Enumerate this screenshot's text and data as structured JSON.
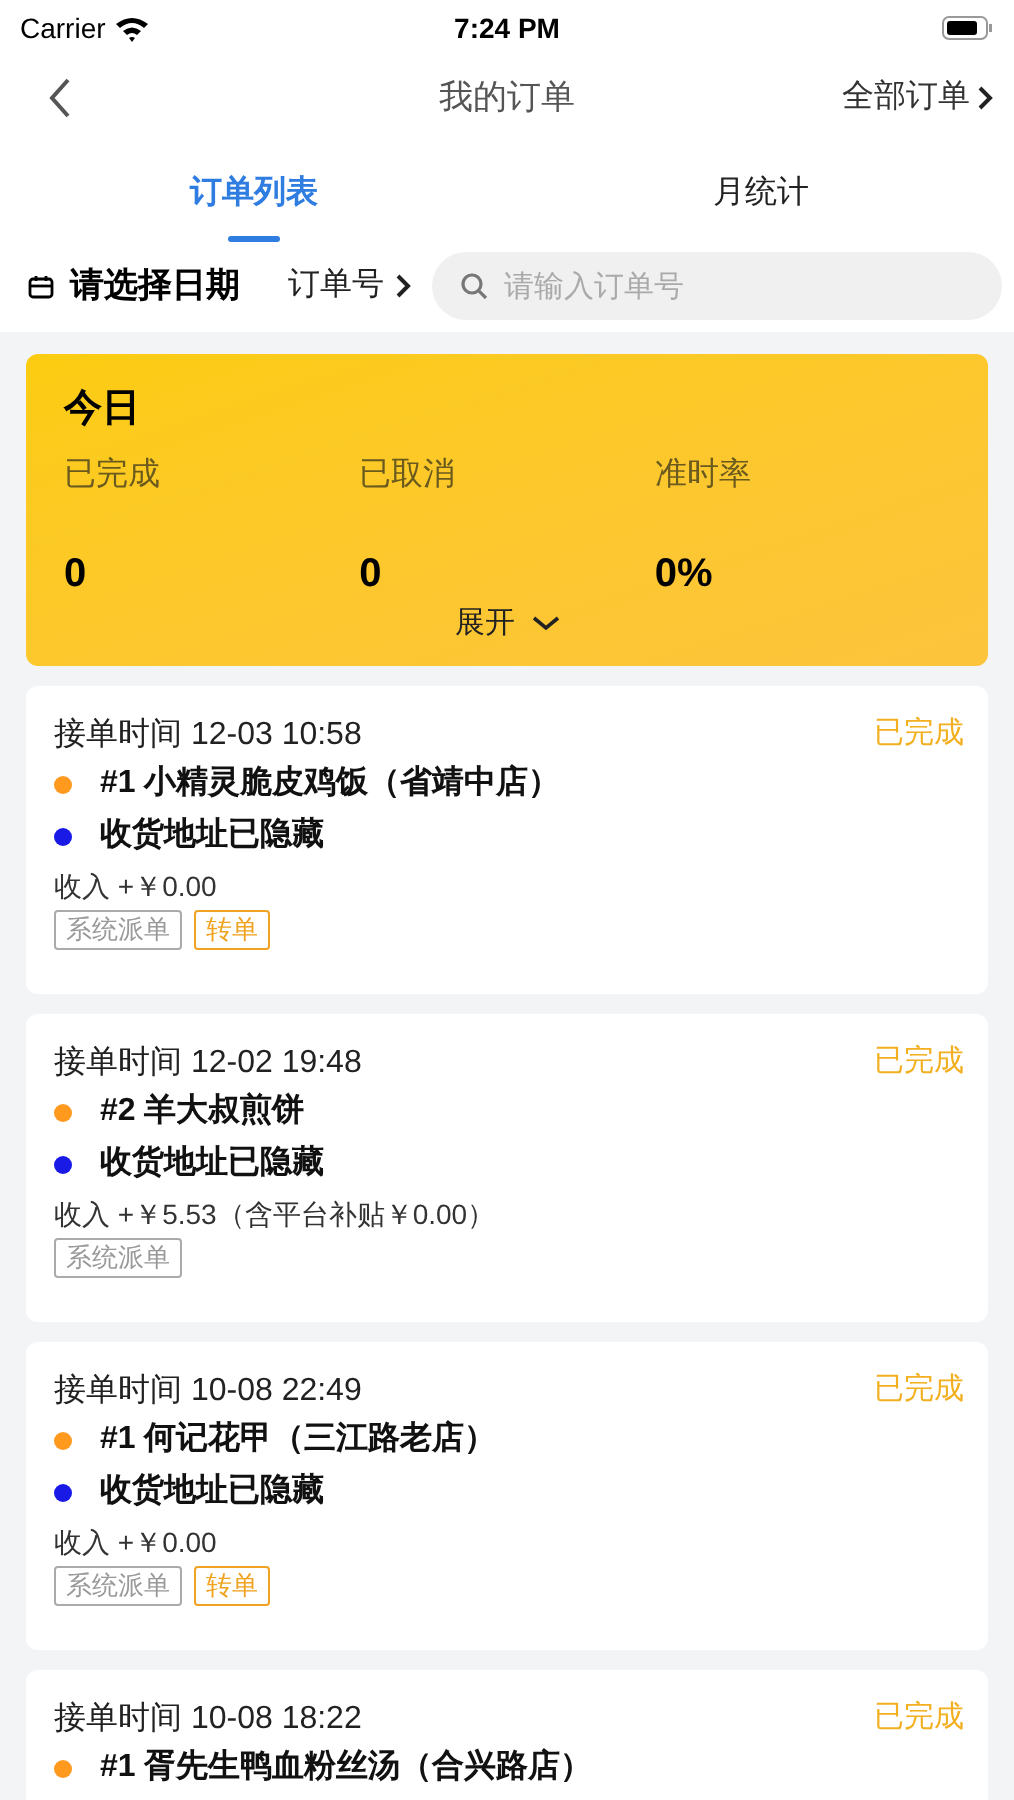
{
  "status_bar": {
    "carrier": "Carrier",
    "time": "7:24 PM"
  },
  "nav": {
    "title": "我的订单",
    "right": "全部订单"
  },
  "tabs": [
    {
      "label": "订单列表",
      "selected": true
    },
    {
      "label": "月统计",
      "selected": false
    }
  ],
  "filter": {
    "date": "请选择日期",
    "order_no": "订单号",
    "search": {
      "placeholder": "请输入订单号"
    }
  },
  "today": {
    "title": "今日",
    "stats": [
      {
        "label": "已完成",
        "value": "0"
      },
      {
        "label": "已取消",
        "value": "0"
      },
      {
        "label": "准时率",
        "value": "0%"
      }
    ],
    "expand": "展开"
  },
  "orders": [
    {
      "time": "接单时间 12-03 10:58",
      "status": "已完成",
      "lines": [
        {
          "text": "#1 小精灵脆皮鸡饭（省靖中店）",
          "color": "#ff9a1f"
        },
        {
          "text": "收货地址已隐藏",
          "color": "#1a1ae6"
        }
      ],
      "income": "收入 +￥0.00",
      "tags": [
        {
          "label": "系统派单",
          "kind": "plain"
        },
        {
          "label": "转单",
          "kind": "accent"
        }
      ]
    },
    {
      "time": "接单时间 12-02 19:48",
      "status": "已完成",
      "lines": [
        {
          "text": "#2 羊大叔煎饼",
          "color": "#ff9a1f"
        },
        {
          "text": "收货地址已隐藏",
          "color": "#1a1ae6"
        }
      ],
      "income": "收入 +￥5.53（含平台补贴￥0.00）",
      "tags": [
        {
          "label": "系统派单",
          "kind": "plain"
        }
      ]
    },
    {
      "time": "接单时间 10-08 22:49",
      "status": "已完成",
      "lines": [
        {
          "text": "#1 何记花甲（三江路老店）",
          "color": "#ff9a1f"
        },
        {
          "text": "收货地址已隐藏",
          "color": "#1a1ae6"
        }
      ],
      "income": "收入 +￥0.00",
      "tags": [
        {
          "label": "系统派单",
          "kind": "plain"
        },
        {
          "label": "转单",
          "kind": "accent"
        }
      ]
    },
    {
      "time": "接单时间 10-08 18:22",
      "status": "已完成",
      "lines": [
        {
          "text": "#1 胥先生鸭血粉丝汤（合兴路店）",
          "color": "#ff9a1f"
        }
      ]
    }
  ]
}
